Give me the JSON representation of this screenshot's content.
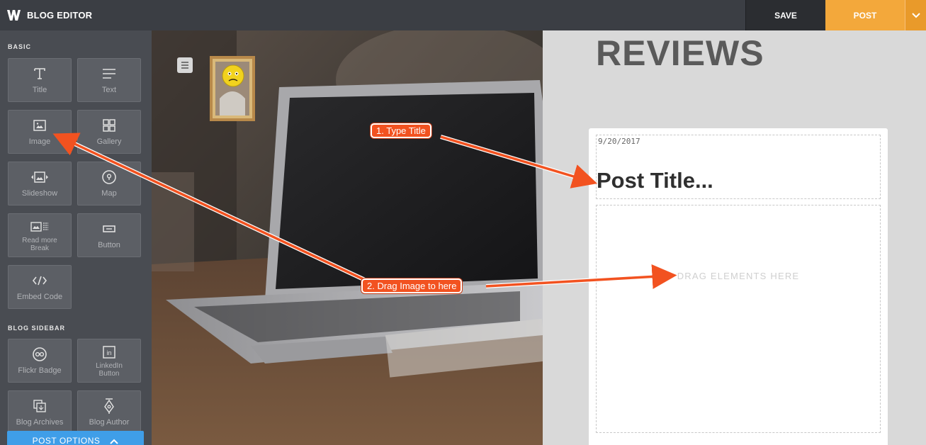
{
  "app": {
    "title": "BLOG EDITOR",
    "logo_icon": "weebly-w-logo"
  },
  "topbar": {
    "save_label": "SAVE",
    "post_label": "POST",
    "post_menu_icon": "chevron-down-icon"
  },
  "sidebar": {
    "basic_label": "BASIC",
    "basic_items": [
      {
        "label": "Title",
        "icon": "title-icon"
      },
      {
        "label": "Text",
        "icon": "text-icon"
      },
      {
        "label": "Image",
        "icon": "image-icon"
      },
      {
        "label": "Gallery",
        "icon": "gallery-icon"
      },
      {
        "label": "Slideshow",
        "icon": "slideshow-icon"
      },
      {
        "label": "Map",
        "icon": "map-pin-icon"
      },
      {
        "label_line1": "Read more",
        "label_line2": "Break",
        "icon": "read-more-icon"
      },
      {
        "label": "Button",
        "icon": "button-icon"
      },
      {
        "label": "Embed Code",
        "icon": "embed-code-icon"
      }
    ],
    "blog_sidebar_label": "BLOG SIDEBAR",
    "blog_items": [
      {
        "label": "Flickr Badge",
        "icon": "flickr-icon"
      },
      {
        "label_line1": "LinkedIn",
        "label_line2": "Button",
        "icon": "linkedin-icon"
      },
      {
        "label": "Blog Archives",
        "icon": "archive-icon"
      },
      {
        "label": "Blog Author",
        "icon": "author-pen-icon"
      }
    ],
    "post_options_label": "POST OPTIONS",
    "post_options_icon": "chevron-up-icon"
  },
  "content": {
    "heading": "REVIEWS",
    "post_date": "9/20/2017",
    "post_title_placeholder": "Post Title...",
    "drop_zone_text": "DRAG ELEMENTS HERE"
  },
  "annotations": {
    "callout_1": "1. Type Title",
    "callout_2": "2. Drag Image to here",
    "arrow_color": "#f25220"
  },
  "colors": {
    "topbar": "#3b3e44",
    "sidebar": "#494c52",
    "post_button": "#f3a83b",
    "post_options": "#3f9ee8"
  }
}
